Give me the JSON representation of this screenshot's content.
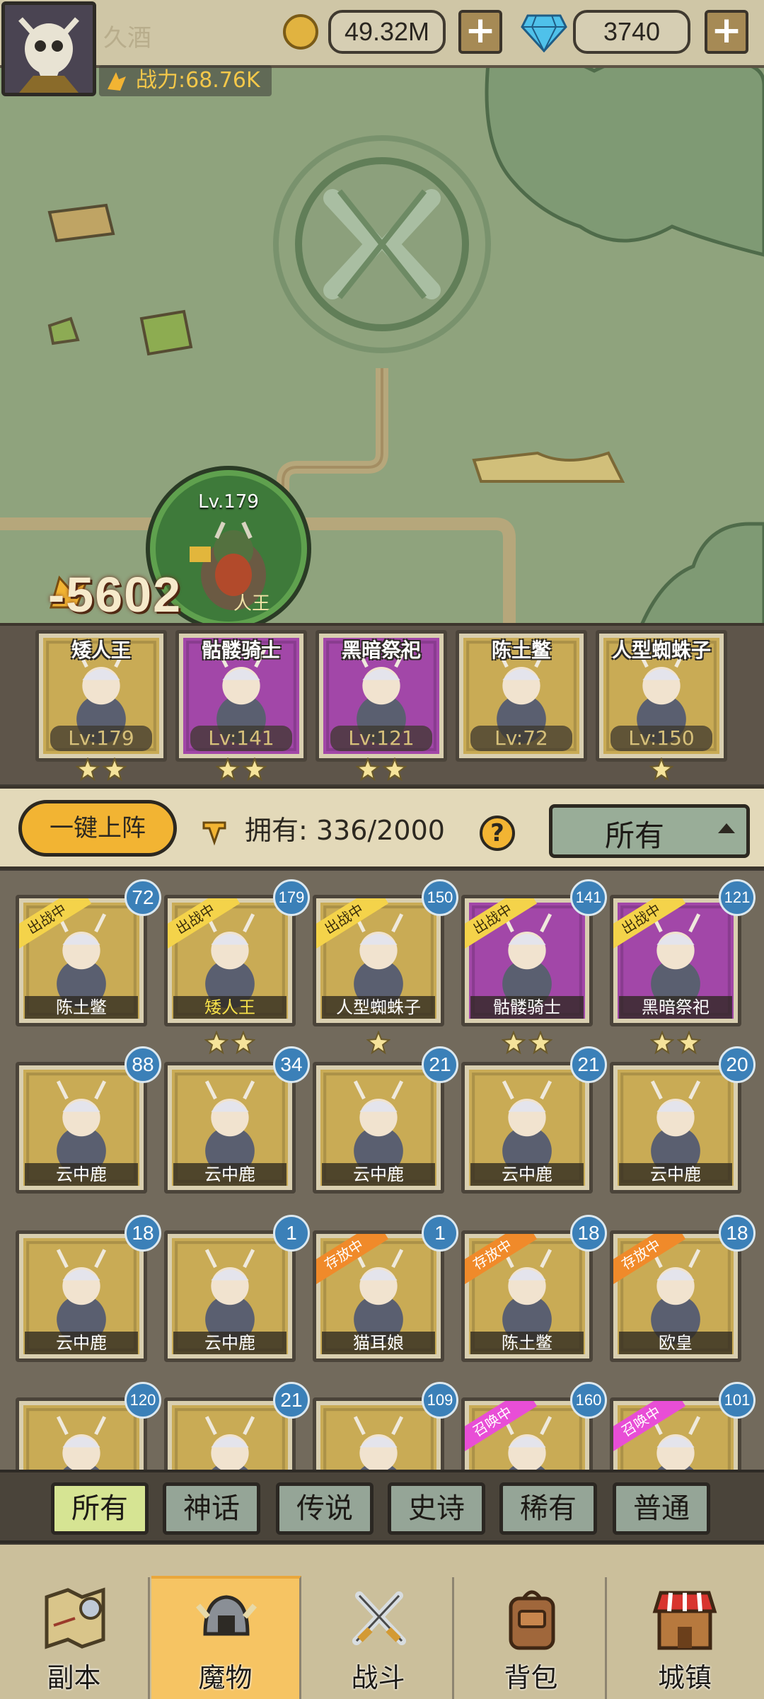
{
  "player": {
    "name": "久酒",
    "power": "战力:68.76K"
  },
  "resources": {
    "gold": "49.32M",
    "gems": "3740"
  },
  "selected_hero": {
    "level": "Lv.179",
    "name_fragment": "人王",
    "damage": "-5602"
  },
  "lineup": [
    {
      "name": "矮人王",
      "level": "Lv:179",
      "stars": 2,
      "color": "#c9ab55"
    },
    {
      "name": "骷髅骑士",
      "level": "Lv:141",
      "stars": 2,
      "color": "#a247a8"
    },
    {
      "name": "黑暗祭祀",
      "level": "Lv:121",
      "stars": 2,
      "color": "#a247a8"
    },
    {
      "name": "陈土鳖",
      "level": "Lv:72",
      "stars": 0,
      "color": "#c9ab55"
    },
    {
      "name": "人型蜘蛛子",
      "level": "Lv:150",
      "stars": 1,
      "color": "#c9ab55"
    }
  ],
  "bench_header": {
    "deploy_label": "一键上阵",
    "owned_label": "拥有: 336/2000",
    "help": "?",
    "filter": "所有"
  },
  "monsters": [
    {
      "name": "陈土鳖",
      "level": "72",
      "ribbon": "出战中",
      "ribbon_type": "deploy",
      "stars": 0,
      "color": "#c9ab55"
    },
    {
      "name": "矮人王",
      "level": "179",
      "ribbon": "出战中",
      "ribbon_type": "deploy",
      "stars": 2,
      "color": "#c9ab55",
      "name_color": "#f5e04a"
    },
    {
      "name": "人型蜘蛛子",
      "level": "150",
      "ribbon": "出战中",
      "ribbon_type": "deploy",
      "stars": 1,
      "color": "#c9ab55"
    },
    {
      "name": "骷髅骑士",
      "level": "141",
      "ribbon": "出战中",
      "ribbon_type": "deploy",
      "stars": 2,
      "color": "#a247a8"
    },
    {
      "name": "黑暗祭祀",
      "level": "121",
      "ribbon": "出战中",
      "ribbon_type": "deploy",
      "stars": 2,
      "color": "#a247a8"
    },
    {
      "name": "云中鹿",
      "level": "88",
      "ribbon": "",
      "ribbon_type": "",
      "stars": 0,
      "color": "#c9ab55"
    },
    {
      "name": "云中鹿",
      "level": "34",
      "ribbon": "",
      "ribbon_type": "",
      "stars": 0,
      "color": "#c9ab55"
    },
    {
      "name": "云中鹿",
      "level": "21",
      "ribbon": "",
      "ribbon_type": "",
      "stars": 0,
      "color": "#c9ab55"
    },
    {
      "name": "云中鹿",
      "level": "21",
      "ribbon": "",
      "ribbon_type": "",
      "stars": 0,
      "color": "#c9ab55"
    },
    {
      "name": "云中鹿",
      "level": "20",
      "ribbon": "",
      "ribbon_type": "",
      "stars": 0,
      "color": "#c9ab55"
    },
    {
      "name": "云中鹿",
      "level": "18",
      "ribbon": "",
      "ribbon_type": "",
      "stars": 0,
      "color": "#c9ab55"
    },
    {
      "name": "云中鹿",
      "level": "1",
      "ribbon": "",
      "ribbon_type": "",
      "stars": 0,
      "color": "#c9ab55"
    },
    {
      "name": "猫耳娘",
      "level": "1",
      "ribbon": "存放中",
      "ribbon_type": "stash",
      "stars": 0,
      "color": "#c9ab55"
    },
    {
      "name": "陈土鳖",
      "level": "18",
      "ribbon": "存放中",
      "ribbon_type": "stash",
      "stars": 0,
      "color": "#c9ab55"
    },
    {
      "name": "欧皇",
      "level": "18",
      "ribbon": "存放中",
      "ribbon_type": "stash",
      "stars": 0,
      "color": "#c9ab55"
    },
    {
      "name": "",
      "level": "120",
      "ribbon": "",
      "ribbon_type": "",
      "stars": 0,
      "color": "#c9ab55"
    },
    {
      "name": "",
      "level": "21",
      "ribbon": "",
      "ribbon_type": "",
      "stars": 0,
      "color": "#c9ab55"
    },
    {
      "name": "",
      "level": "109",
      "ribbon": "",
      "ribbon_type": "",
      "stars": 0,
      "color": "#c9ab55"
    },
    {
      "name": "",
      "level": "160",
      "ribbon": "召唤中",
      "ribbon_type": "summon",
      "stars": 0,
      "color": "#c9ab55"
    },
    {
      "name": "",
      "level": "101",
      "ribbon": "召唤中",
      "ribbon_type": "summon",
      "stars": 0,
      "color": "#c9ab55"
    }
  ],
  "rarity_tabs": [
    "所有",
    "神话",
    "传说",
    "史诗",
    "稀有",
    "普通"
  ],
  "active_rarity": 0,
  "nav": [
    {
      "label": "副本",
      "icon": "map-icon"
    },
    {
      "label": "魔物",
      "icon": "helmet-icon"
    },
    {
      "label": "战斗",
      "icon": "swords-icon"
    },
    {
      "label": "背包",
      "icon": "backpack-icon"
    },
    {
      "label": "城镇",
      "icon": "shop-icon"
    }
  ],
  "active_nav": 1,
  "colors": {
    "accent": "#f2b433",
    "badge": "#3b80b8",
    "epic": "#a247a8",
    "gold_card": "#c9ab55",
    "map": "#8fa37d"
  }
}
